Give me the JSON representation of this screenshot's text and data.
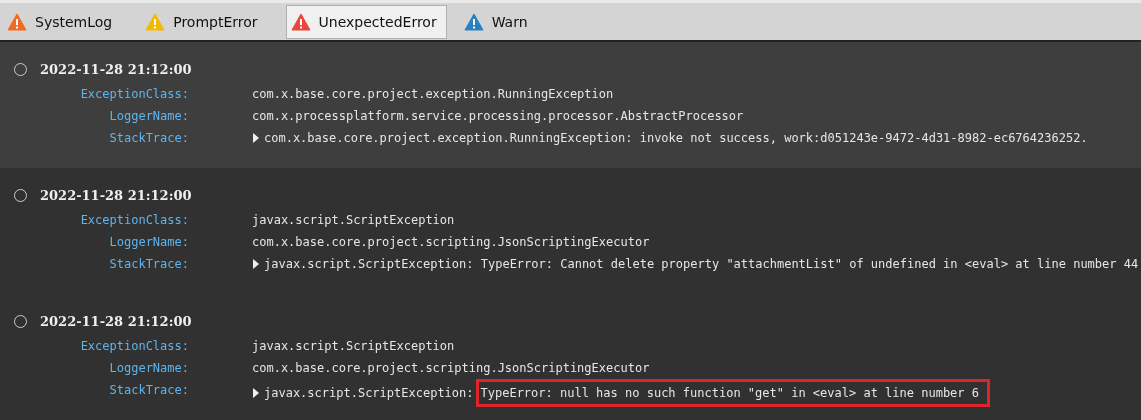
{
  "tabs": [
    {
      "label": "SystemLog",
      "color": "#f26a21",
      "selected": false
    },
    {
      "label": "PromptError",
      "color": "#f5b800",
      "selected": false
    },
    {
      "label": "UnexpectedError",
      "color": "#e8473c",
      "selected": true
    },
    {
      "label": "Warn",
      "color": "#2a7fc1",
      "selected": false
    }
  ],
  "entries": [
    {
      "time": "2022-11-28 21:12:00",
      "highlighted": true,
      "fields": [
        {
          "kind": "text",
          "label": "ExceptionClass:",
          "value": "com.x.base.core.project.exception.RunningException"
        },
        {
          "kind": "text",
          "label": "LoggerName:",
          "value": "com.x.processplatform.service.processing.processor.AbstractProcessor"
        },
        {
          "kind": "stack",
          "label": "StackTrace:",
          "expanded": false,
          "value": "com.x.base.core.project.exception.RunningException: invoke not success, work:d051243e-9472-4d31-8982-ec6764236252."
        }
      ]
    },
    {
      "time": "2022-11-28 21:12:00",
      "highlighted": false,
      "fields": [
        {
          "kind": "text",
          "label": "ExceptionClass:",
          "value": "javax.script.ScriptException"
        },
        {
          "kind": "text",
          "label": "LoggerName:",
          "value": "com.x.base.core.project.scripting.JsonScriptingExecutor"
        },
        {
          "kind": "stack",
          "label": "StackTrace:",
          "expanded": false,
          "value": "javax.script.ScriptException: TypeError: Cannot delete property \"attachmentList\" of undefined in <eval> at line number 44"
        }
      ]
    },
    {
      "time": "2022-11-28 21:12:00",
      "highlighted": false,
      "fields": [
        {
          "kind": "text",
          "label": "ExceptionClass:",
          "value": "javax.script.ScriptException"
        },
        {
          "kind": "text",
          "label": "LoggerName:",
          "value": "com.x.base.core.project.scripting.JsonScriptingExecutor"
        },
        {
          "kind": "stack",
          "label": "StackTrace:",
          "expanded": false,
          "value": "javax.script.ScriptException:",
          "marked": "TypeError: null has no such function \"get\" in <eval> at line number 6"
        }
      ]
    }
  ]
}
